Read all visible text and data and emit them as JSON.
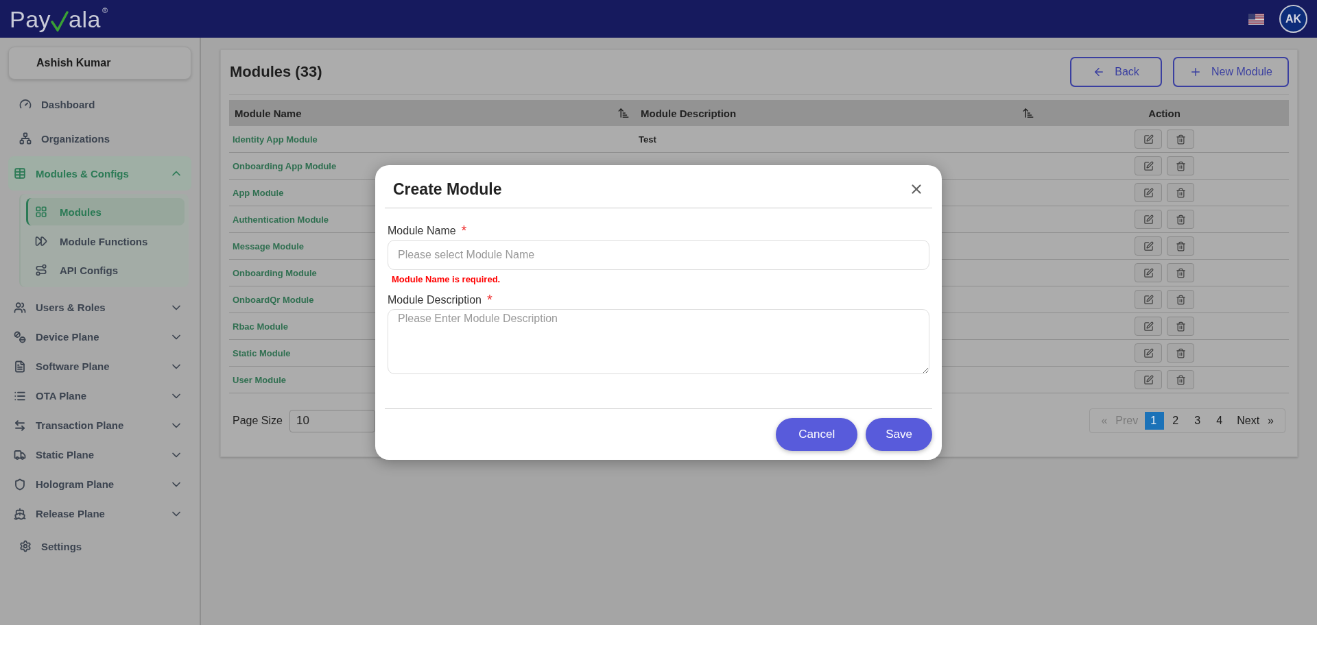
{
  "header": {
    "logo": {
      "before": "Pay",
      "after": "ala",
      "mark": "®"
    },
    "avatar": "AK"
  },
  "sidebar": {
    "user": "Ashish Kumar",
    "items": [
      {
        "label": "Dashboard",
        "kind": "link",
        "selected": false
      },
      {
        "label": "Organizations",
        "kind": "link",
        "selected": false
      },
      {
        "label": "Modules & Configs",
        "kind": "group",
        "selected": true,
        "expanded": true,
        "children": [
          {
            "label": "Modules",
            "selected": true
          },
          {
            "label": "Module Functions",
            "selected": false
          },
          {
            "label": "API Configs",
            "selected": false
          }
        ]
      },
      {
        "label": "Users & Roles",
        "kind": "group",
        "selected": false,
        "expanded": false
      },
      {
        "label": "Device Plane",
        "kind": "group",
        "selected": false,
        "expanded": false
      },
      {
        "label": "Software Plane",
        "kind": "group",
        "selected": false,
        "expanded": false
      },
      {
        "label": "OTA Plane",
        "kind": "group",
        "selected": false,
        "expanded": false
      },
      {
        "label": "Transaction Plane",
        "kind": "group",
        "selected": false,
        "expanded": false
      },
      {
        "label": "Static Plane",
        "kind": "group",
        "selected": false,
        "expanded": false
      },
      {
        "label": "Hologram Plane",
        "kind": "group",
        "selected": false,
        "expanded": false
      },
      {
        "label": "Release Plane",
        "kind": "group",
        "selected": false,
        "expanded": false
      },
      {
        "label": "Settings",
        "kind": "link",
        "selected": false
      }
    ]
  },
  "page": {
    "title": "Modules (33)",
    "buttons": [
      {
        "label": "Back",
        "kind": "back"
      },
      {
        "label": "New Module",
        "kind": "add"
      }
    ]
  },
  "table": {
    "columns": [
      {
        "label": "Module Name",
        "sortable": true
      },
      {
        "label": "Module Description",
        "sortable": true
      },
      {
        "label": "Action",
        "sortable": false
      }
    ],
    "rows": [
      {
        "name": "Identity App Module",
        "description": "Test"
      },
      {
        "name": "Onboarding App Module"
      },
      {
        "name": "App Module"
      },
      {
        "name": "Authentication Module"
      },
      {
        "name": "Message Module"
      },
      {
        "name": "Onboarding Module"
      },
      {
        "name": "OnboardQr Module"
      },
      {
        "name": "Rbac Module"
      },
      {
        "name": "Static Module"
      },
      {
        "name": "User Module"
      }
    ]
  },
  "page_size": {
    "label": "Page Size",
    "value": "10"
  },
  "pagination": {
    "prev": {
      "arrow": "«",
      "label": "Prev",
      "disabled": true
    },
    "pages": [
      {
        "label": "1",
        "selected": true
      },
      {
        "label": "2",
        "selected": false
      },
      {
        "label": "3",
        "selected": false
      },
      {
        "label": "4",
        "selected": false
      }
    ],
    "next": {
      "label": "Next",
      "arrow": "»",
      "disabled": false
    }
  },
  "modal": {
    "title": "Create Module",
    "fields": [
      {
        "kind": "input",
        "label": "Module Name",
        "required_mark": "*",
        "placeholder": "Please select Module Name",
        "error": "Module Name is required."
      },
      {
        "kind": "textarea",
        "label": "Module Description",
        "required_mark": "*",
        "placeholder": "Please Enter Module Description"
      }
    ],
    "buttons": [
      {
        "label": "Cancel",
        "kind": "cancel"
      },
      {
        "label": "Save",
        "kind": "save"
      }
    ]
  }
}
